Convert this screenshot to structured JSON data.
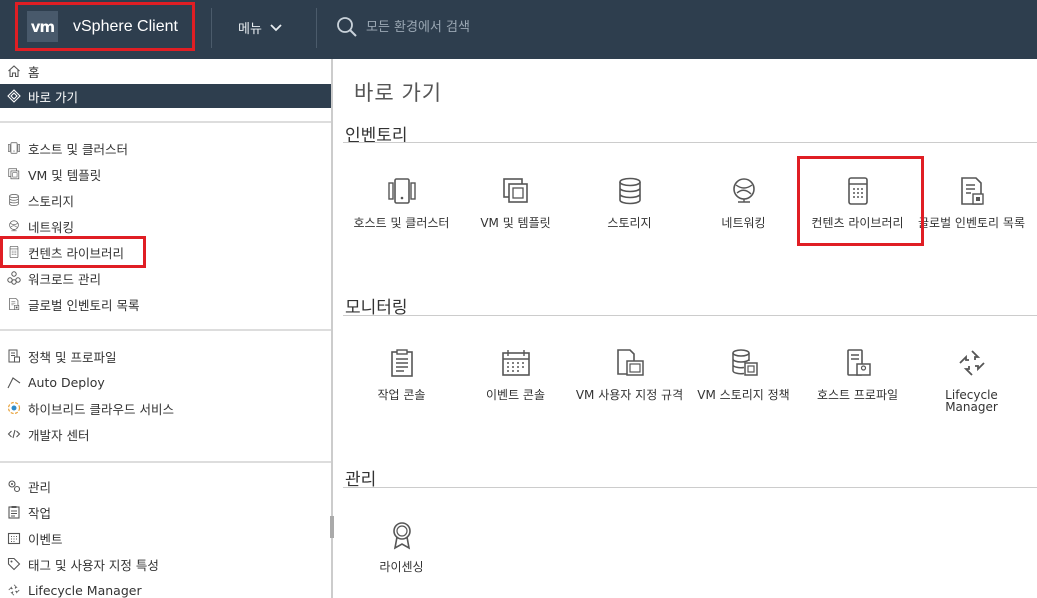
{
  "header": {
    "logo": "vm",
    "title": "vSphere Client",
    "menu_label": "메뉴",
    "search_placeholder": "모든 환경에서 검색"
  },
  "sidebar": {
    "group1": [
      {
        "label": "홈",
        "icon": "home-icon"
      },
      {
        "label": "바로 가기",
        "icon": "shortcuts-icon",
        "active": true
      }
    ],
    "group2": [
      {
        "label": "호스트 및 클러스터",
        "icon": "hosts-clusters-icon"
      },
      {
        "label": "VM 및 템플릿",
        "icon": "vms-templates-icon"
      },
      {
        "label": "스토리지",
        "icon": "storage-icon"
      },
      {
        "label": "네트워킹",
        "icon": "networking-icon"
      },
      {
        "label": "컨텐츠 라이브러리",
        "icon": "content-library-icon",
        "highlighted": true
      },
      {
        "label": "워크로드 관리",
        "icon": "workload-management-icon"
      },
      {
        "label": "글로벌 인벤토리 목록",
        "icon": "global-inventory-icon"
      }
    ],
    "group3": [
      {
        "label": "정책 및 프로파일",
        "icon": "policies-icon"
      },
      {
        "label": "Auto Deploy",
        "icon": "auto-deploy-icon"
      },
      {
        "label": "하이브리드 클라우드 서비스",
        "icon": "hybrid-cloud-icon"
      },
      {
        "label": "개발자 센터",
        "icon": "developer-center-icon"
      }
    ],
    "group4": [
      {
        "label": "관리",
        "icon": "administration-icon"
      },
      {
        "label": "작업",
        "icon": "tasks-icon"
      },
      {
        "label": "이벤트",
        "icon": "events-icon"
      },
      {
        "label": "태그 및 사용자 지정 특성",
        "icon": "tag-icon"
      },
      {
        "label": "Lifecycle Manager",
        "icon": "lifecycle-icon"
      }
    ]
  },
  "main": {
    "title": "바로 가기",
    "sections": [
      {
        "title": "인벤토리",
        "tiles": [
          {
            "label": "호스트 및 클러스터",
            "icon": "hosts-clusters-icon"
          },
          {
            "label": "VM 및 템플릿",
            "icon": "vms-templates-icon"
          },
          {
            "label": "스토리지",
            "icon": "storage-icon"
          },
          {
            "label": "네트워킹",
            "icon": "networking-icon"
          },
          {
            "label": "컨텐츠 라이브러리",
            "icon": "content-library-icon",
            "highlighted": true
          },
          {
            "label": "글로벌 인벤토리 목록",
            "icon": "global-inventory-icon"
          }
        ]
      },
      {
        "title": "모니터링",
        "tiles": [
          {
            "label": "작업 콘솔",
            "icon": "task-console-icon"
          },
          {
            "label": "이벤트 콘솔",
            "icon": "event-console-icon"
          },
          {
            "label": "VM 사용자 지정 규격",
            "icon": "vm-customization-icon"
          },
          {
            "label": "VM 스토리지 정책",
            "icon": "vm-storage-policy-icon"
          },
          {
            "label": "호스트 프로파일",
            "icon": "host-profile-icon"
          },
          {
            "label": "Lifecycle Manager",
            "icon": "lifecycle-icon"
          }
        ]
      },
      {
        "title": "관리",
        "tiles": [
          {
            "label": "라이센싱",
            "icon": "licensing-icon"
          }
        ]
      }
    ]
  },
  "colors": {
    "header_bg": "#2e3e4e",
    "active_bg": "#2e3e4e",
    "highlight": "#e01e24",
    "icon": "#565656"
  }
}
